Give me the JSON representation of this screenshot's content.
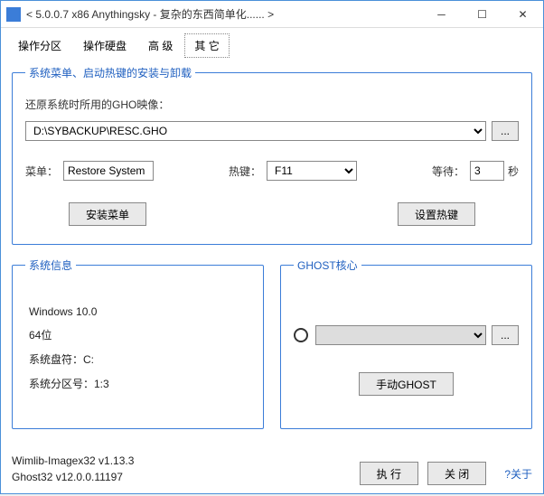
{
  "title": "< 5.0.0.7 x86 Anythingsky - 复杂的东西简单化...... >",
  "tabs": {
    "t1": "操作分区",
    "t2": "操作硬盘",
    "t3": "高 级",
    "t4": "其 它"
  },
  "group1": {
    "legend": "系统菜单、启动热键的安装与卸载",
    "ghoLabel": "还原系统时所用的GHO映像：",
    "ghoPath": "D:\\SYBACKUP\\RESC.GHO",
    "browse": "...",
    "menuLabel": "菜单：",
    "menuValue": "Restore System",
    "hotkeyLabel": "热键：",
    "hotkeyValue": "F11",
    "waitLabel": "等待：",
    "waitValue": "3",
    "waitUnit": "秒",
    "installBtn": "安装菜单",
    "setHotkeyBtn": "设置热键"
  },
  "sysinfo": {
    "legend": "系统信息",
    "os": "Windows 10.0",
    "bits": "64位",
    "sysDrive": "系统盘符：C:",
    "sysPart": "系统分区号：1:3"
  },
  "ghost": {
    "legend": "GHOST核心",
    "browse": "...",
    "manualBtn": "手动GHOST"
  },
  "footer": {
    "line1": "Wimlib-Imagex32 v1.13.3",
    "line2": "Ghost32 v12.0.0.11197",
    "execBtn": "执 行",
    "closeBtn": "关 闭",
    "about": "?关于"
  }
}
